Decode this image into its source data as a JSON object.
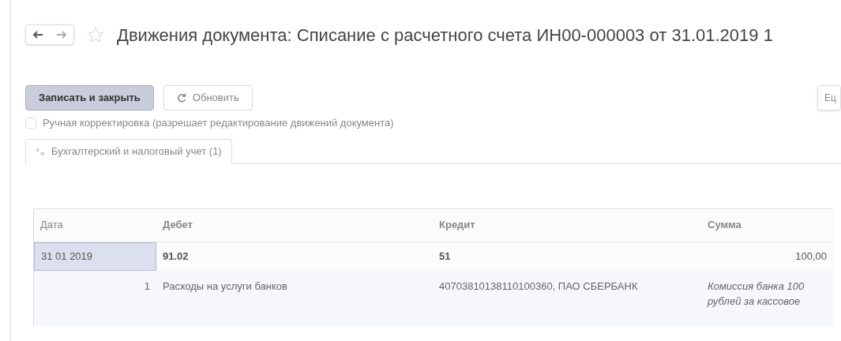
{
  "window": {
    "title": "Движения документа: Списание с расчетного счета ИН00-000003 от 31.01.2019 1"
  },
  "toolbar": {
    "buttons": [
      {
        "label": "Записать и закрыть",
        "kind": "primary"
      },
      {
        "label": "Обновить",
        "kind": "refresh"
      }
    ],
    "more_button": "Ец"
  },
  "manual_edit": {
    "label": "Ручная корректировка (разрешает редактирование движений документа)",
    "checked": false
  },
  "tabs": [
    {
      "label": "Бухгалтерский и налоговый учет (1)",
      "selected": true
    }
  ],
  "table": {
    "columns": [
      "Дата",
      "Дебет",
      "Кредит",
      "Сумма"
    ],
    "rows": [
      {
        "date": "31 01 2019",
        "debit": "91.02",
        "credit": "51",
        "amount": "100,00",
        "selected": true,
        "sub": {
          "number": "1",
          "debit": "Расходы на услуги банков",
          "credit": "40703810138110100360, ПАО СБЕРБАНК",
          "content": "Комиссия банка 100 рублей за кассовое"
        }
      }
    ]
  }
}
